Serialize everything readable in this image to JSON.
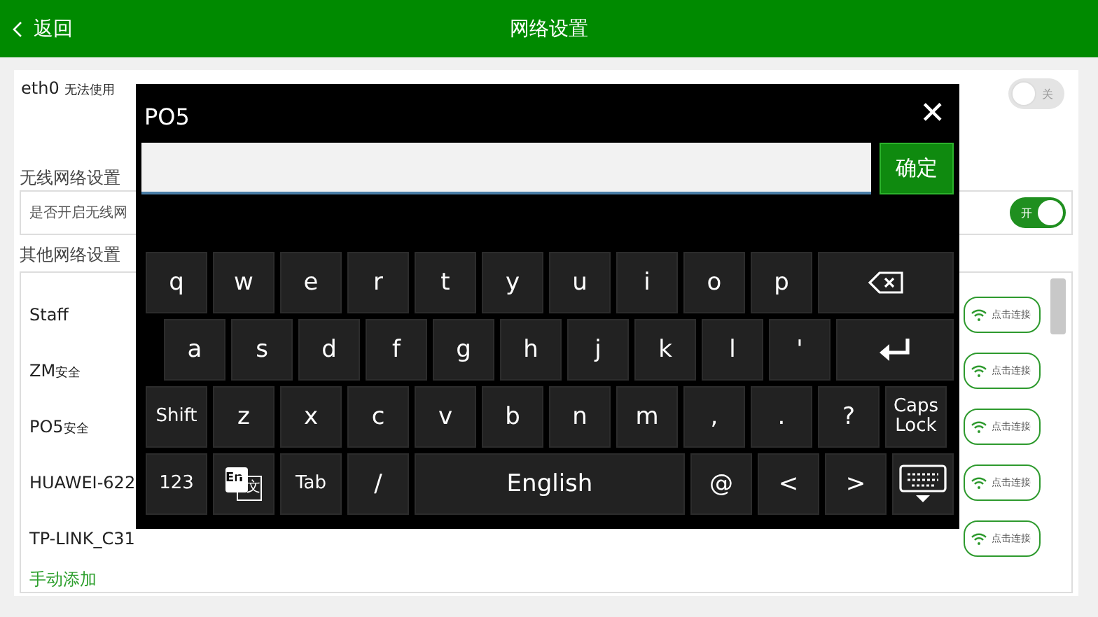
{
  "header": {
    "back": "返回",
    "title": "网络设置"
  },
  "eth": {
    "name": "eth0",
    "status": "无法使用",
    "toggle": {
      "label": "关",
      "on": false
    }
  },
  "wireless": {
    "heading": "无线网络设置",
    "question": "是否开启无线网",
    "toggle": {
      "label": "开",
      "on": true
    }
  },
  "others": {
    "heading": "其他网络设置",
    "networks": [
      {
        "name": "Staff",
        "button": "点击连接"
      },
      {
        "name": "ZM",
        "security": "安全",
        "button": "点击连接"
      },
      {
        "name": "PO5",
        "security": "安全",
        "button": "点击连接"
      },
      {
        "name": "HUAWEI-622",
        "button": "点击连接"
      },
      {
        "name": "TP-LINK_C31",
        "button": "点击连接"
      }
    ],
    "add": "手动添加"
  },
  "keyboard": {
    "title": "PO5",
    "confirm": "确定",
    "close": "✕",
    "rows": [
      {
        "keys": [
          {
            "kind": "char",
            "label": "q"
          },
          {
            "kind": "char",
            "label": "w"
          },
          {
            "kind": "char",
            "label": "e"
          },
          {
            "kind": "char",
            "label": "r"
          },
          {
            "kind": "char",
            "label": "t"
          },
          {
            "kind": "char",
            "label": "y"
          },
          {
            "kind": "char",
            "label": "u"
          },
          {
            "kind": "char",
            "label": "i"
          },
          {
            "kind": "char",
            "label": "o"
          },
          {
            "kind": "char",
            "label": "p"
          },
          {
            "kind": "backspace"
          }
        ]
      },
      {
        "keys": [
          {
            "kind": "char",
            "label": "a"
          },
          {
            "kind": "char",
            "label": "s"
          },
          {
            "kind": "char",
            "label": "d"
          },
          {
            "kind": "char",
            "label": "f"
          },
          {
            "kind": "char",
            "label": "g"
          },
          {
            "kind": "char",
            "label": "h"
          },
          {
            "kind": "char",
            "label": "j"
          },
          {
            "kind": "char",
            "label": "k"
          },
          {
            "kind": "char",
            "label": "l"
          },
          {
            "kind": "char",
            "label": "'"
          },
          {
            "kind": "enter"
          }
        ]
      },
      {
        "keys": [
          {
            "kind": "small",
            "label": "Shift"
          },
          {
            "kind": "char",
            "label": "z"
          },
          {
            "kind": "char",
            "label": "x"
          },
          {
            "kind": "char",
            "label": "c"
          },
          {
            "kind": "char",
            "label": "v"
          },
          {
            "kind": "char",
            "label": "b"
          },
          {
            "kind": "char",
            "label": "n"
          },
          {
            "kind": "char",
            "label": "m"
          },
          {
            "kind": "char",
            "label": ","
          },
          {
            "kind": "char",
            "label": "."
          },
          {
            "kind": "char",
            "label": "?"
          },
          {
            "kind": "small",
            "label": "Caps Lock"
          }
        ]
      },
      {
        "keys": [
          {
            "kind": "small",
            "label": "123"
          },
          {
            "kind": "lang",
            "label": "En",
            "label2": "文"
          },
          {
            "kind": "small",
            "label": "Tab"
          },
          {
            "kind": "char",
            "label": "/"
          },
          {
            "kind": "space",
            "label": "English"
          },
          {
            "kind": "char",
            "label": "@"
          },
          {
            "kind": "char",
            "label": "<"
          },
          {
            "kind": "char",
            "label": ">"
          },
          {
            "kind": "hide"
          }
        ]
      }
    ]
  }
}
